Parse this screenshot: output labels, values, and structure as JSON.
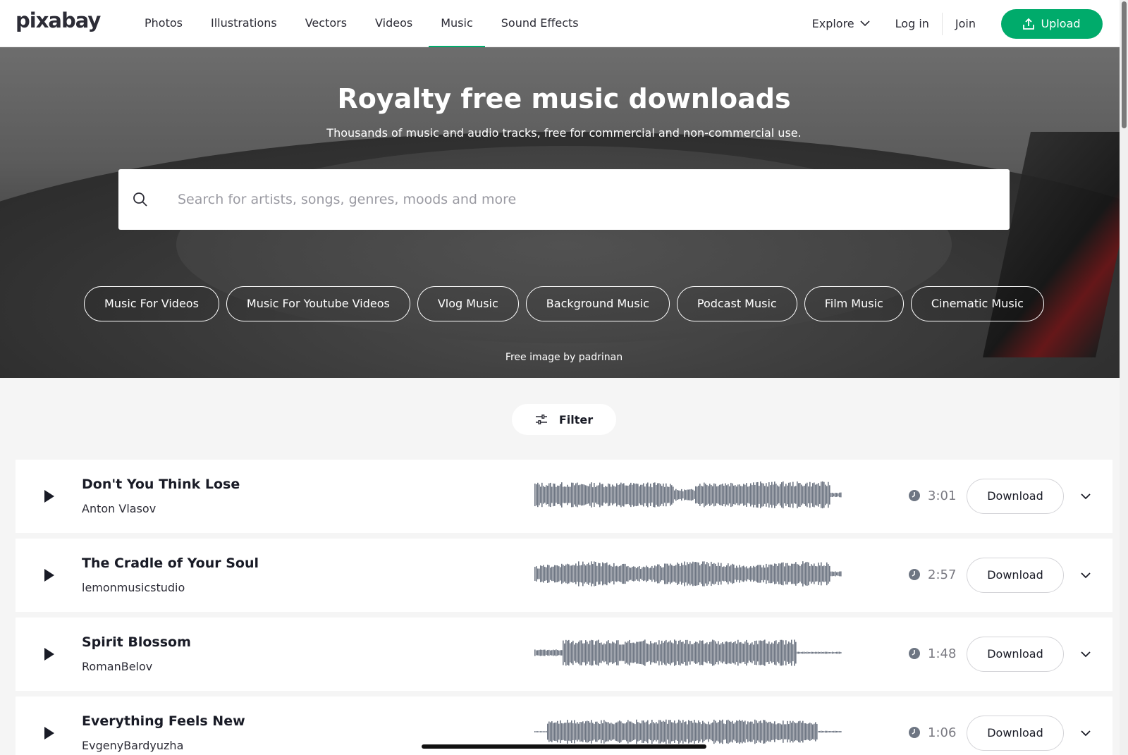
{
  "header": {
    "logo": "pixabay",
    "nav": [
      "Photos",
      "Illustrations",
      "Vectors",
      "Videos",
      "Music",
      "Sound Effects"
    ],
    "active_nav": "Music",
    "explore": "Explore",
    "login": "Log in",
    "join": "Join",
    "upload": "Upload"
  },
  "hero": {
    "title": "Royalty free music downloads",
    "subtitle": "Thousands of music and audio tracks, free for commercial and non-commercial use.",
    "search_placeholder": "Search for artists, songs, genres, moods and more",
    "chips": [
      "Music For Videos",
      "Music For Youtube Videos",
      "Vlog Music",
      "Background Music",
      "Podcast Music",
      "Film Music",
      "Cinematic Music"
    ],
    "credit": "Free image by padrinan"
  },
  "filter": {
    "label": "Filter"
  },
  "tracks": [
    {
      "title": "Don't You Think Lose",
      "artist": "Anton Vlasov",
      "duration": "3:01",
      "download": "Download"
    },
    {
      "title": "The Cradle of Your Soul",
      "artist": "lemonmusicstudio",
      "duration": "2:57",
      "download": "Download"
    },
    {
      "title": "Spirit Blossom",
      "artist": "RomanBelov",
      "duration": "1:48",
      "download": "Download"
    },
    {
      "title": "Everything Feels New",
      "artist": "EvgenyBardyuzha",
      "duration": "1:06",
      "download": "Download"
    }
  ],
  "colors": {
    "accent": "#00ab6b",
    "waveform": "#6e7683",
    "text": "#191b26"
  }
}
